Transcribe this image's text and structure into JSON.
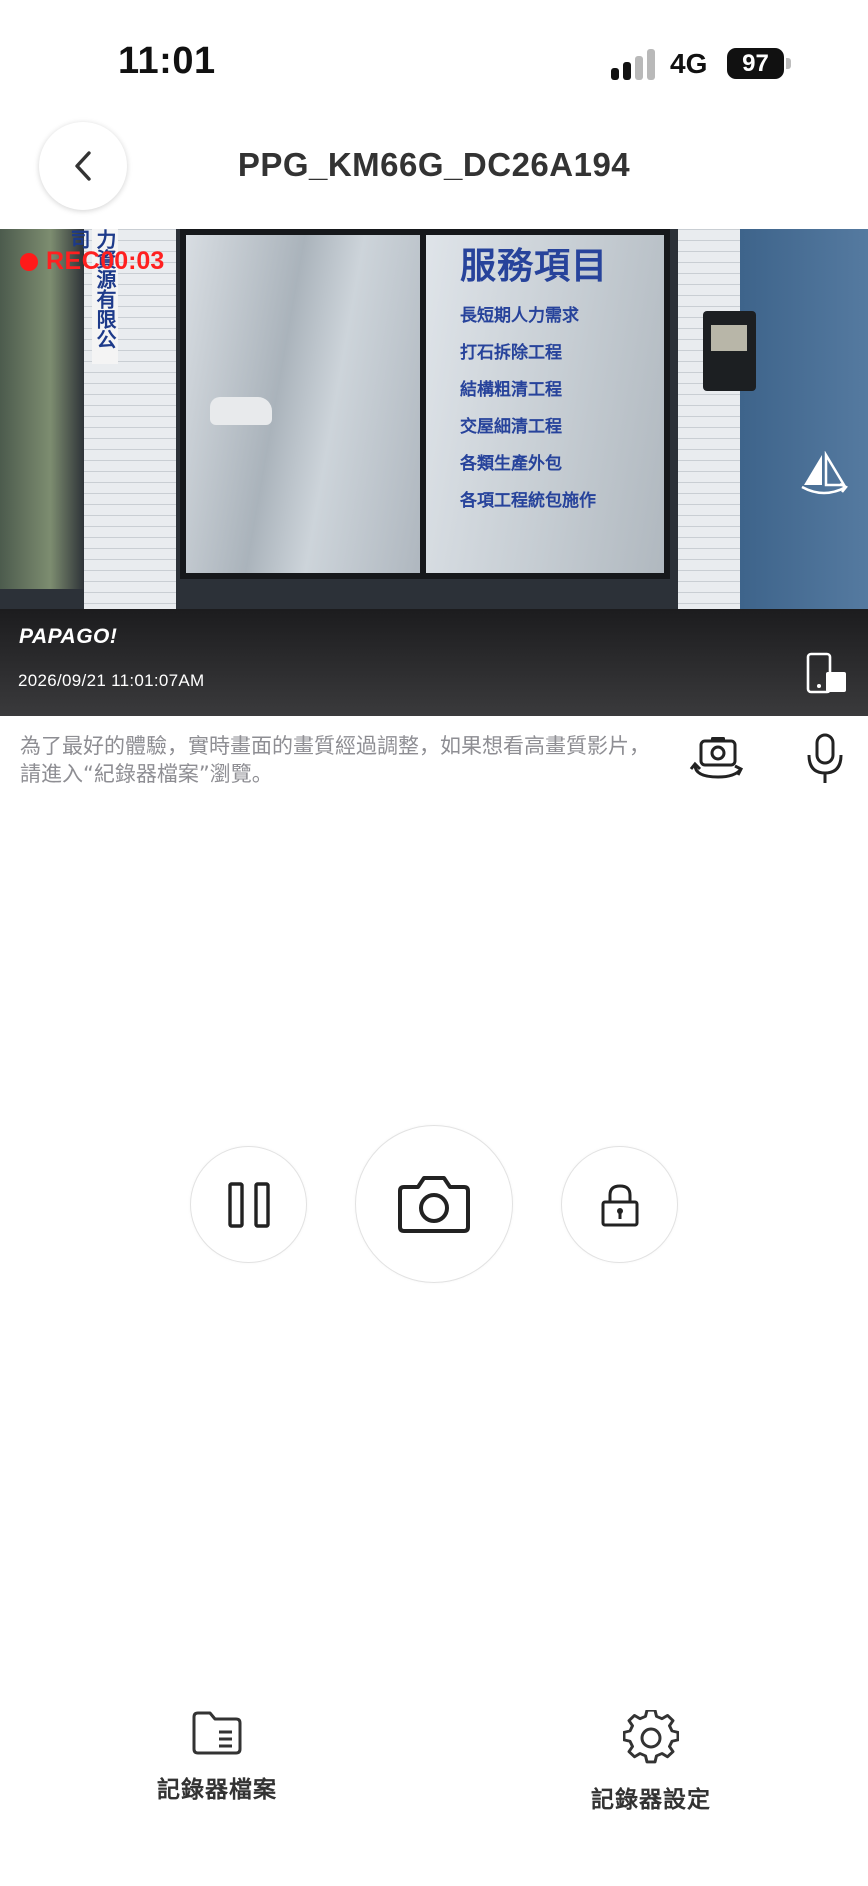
{
  "status_bar": {
    "time": "11:01",
    "network": "4G",
    "battery": "97"
  },
  "header": {
    "title": "PPG_KM66G_DC26A194",
    "back_icon": "chevron-left-icon"
  },
  "video": {
    "rec_label": "REC",
    "rec_timer": "00:03",
    "brand": "PAPAGO!",
    "timestamp": "2026/09/21 11:01:07AM",
    "scene_sign_title": "服務項目",
    "scene_sign_items": [
      "長短期人力需求",
      "打石拆除工程",
      "結構粗清工程",
      "交屋細清工程",
      "各類生產外包",
      "各項工程統包施作"
    ],
    "scene_banner": "力資源有限公司",
    "icons": [
      "flip-icon",
      "screen-rotate-icon"
    ],
    "rec_color": "#ff2020"
  },
  "notice": "為了最好的體驗，實時畫面的畫質經過調整，如果想看高畫質影片，請進入“紀錄器檔案”瀏覽。",
  "tools": {
    "switch_camera_icon": "camera-switch-icon",
    "microphone_icon": "microphone-icon"
  },
  "controls": {
    "pause_icon": "pause-icon",
    "snapshot_icon": "camera-icon",
    "lock_icon": "lock-icon"
  },
  "bottom_nav": {
    "files_label": "記錄器檔案",
    "settings_label": "記錄器設定",
    "files_icon": "folder-icon",
    "settings_icon": "gear-icon"
  }
}
